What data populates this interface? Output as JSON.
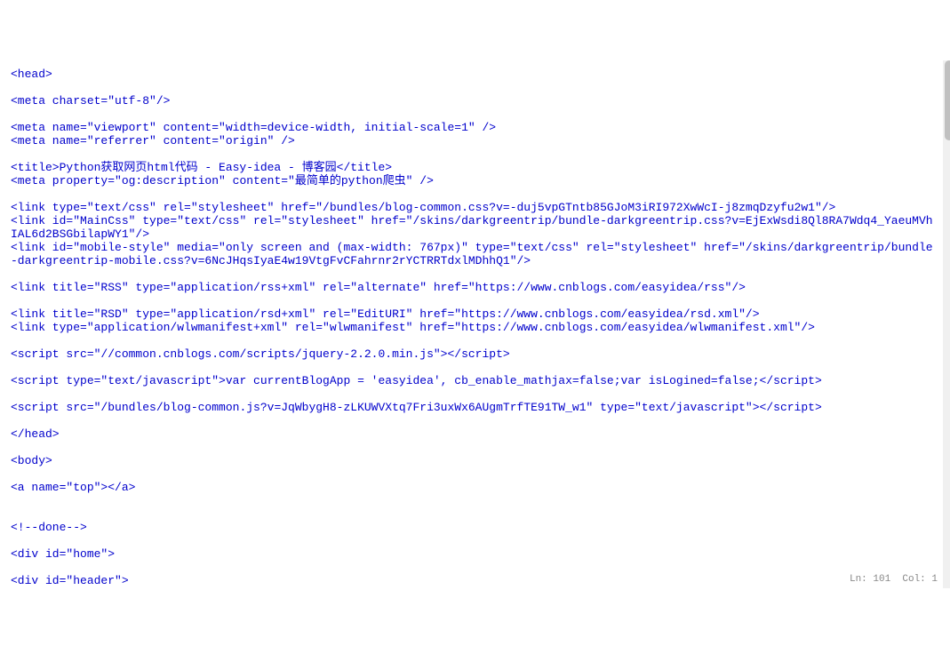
{
  "code": {
    "lines": [
      "<head>",
      "",
      "<meta charset=\"utf-8\"/>",
      "",
      "<meta name=\"viewport\" content=\"width=device-width, initial-scale=1\" />",
      "<meta name=\"referrer\" content=\"origin\" />",
      "",
      "<title>Python获取网页html代码 - Easy-idea - 博客园</title>",
      "<meta property=\"og:description\" content=\"最简单的python爬虫\" />",
      "",
      "<link type=\"text/css\" rel=\"stylesheet\" href=\"/bundles/blog-common.css?v=-duj5vpGTntb85GJoM3iRI972XwWcI-j8zmqDzyfu2w1\"/>",
      "<link id=\"MainCss\" type=\"text/css\" rel=\"stylesheet\" href=\"/skins/darkgreentrip/bundle-darkgreentrip.css?v=EjExWsdi8Ql8RA7Wdq4_YaeuMVhIAL6d2BSGbilapWY1\"/>",
      "<link id=\"mobile-style\" media=\"only screen and (max-width: 767px)\" type=\"text/css\" rel=\"stylesheet\" href=\"/skins/darkgreentrip/bundle-darkgreentrip-mobile.css?v=6NcJHqsIyaE4w19VtgFvCFahrnr2rYCTRRTdxlMDhhQ1\"/>",
      "",
      "<link title=\"RSS\" type=\"application/rss+xml\" rel=\"alternate\" href=\"https://www.cnblogs.com/easyidea/rss\"/>",
      "",
      "<link title=\"RSD\" type=\"application/rsd+xml\" rel=\"EditURI\" href=\"https://www.cnblogs.com/easyidea/rsd.xml\"/>",
      "<link type=\"application/wlwmanifest+xml\" rel=\"wlwmanifest\" href=\"https://www.cnblogs.com/easyidea/wlwmanifest.xml\"/>",
      "",
      "<script src=\"//common.cnblogs.com/scripts/jquery-2.2.0.min.js\"></script>",
      "",
      "<script type=\"text/javascript\">var currentBlogApp = 'easyidea', cb_enable_mathjax=false;var isLogined=false;</script>",
      "",
      "<script src=\"/bundles/blog-common.js?v=JqWbygH8-zLKUWVXtq7Fri3uxWx6AUgmTrfTE91TW_w1\" type=\"text/javascript\"></script>",
      "",
      "</head>",
      "",
      "<body>",
      "",
      "<a name=\"top\"></a>",
      "",
      "",
      "<!--done-->",
      "",
      "<div id=\"home\">",
      "",
      "<div id=\"header\">"
    ]
  },
  "status": {
    "text": "Ln: 101  Col: 1"
  }
}
